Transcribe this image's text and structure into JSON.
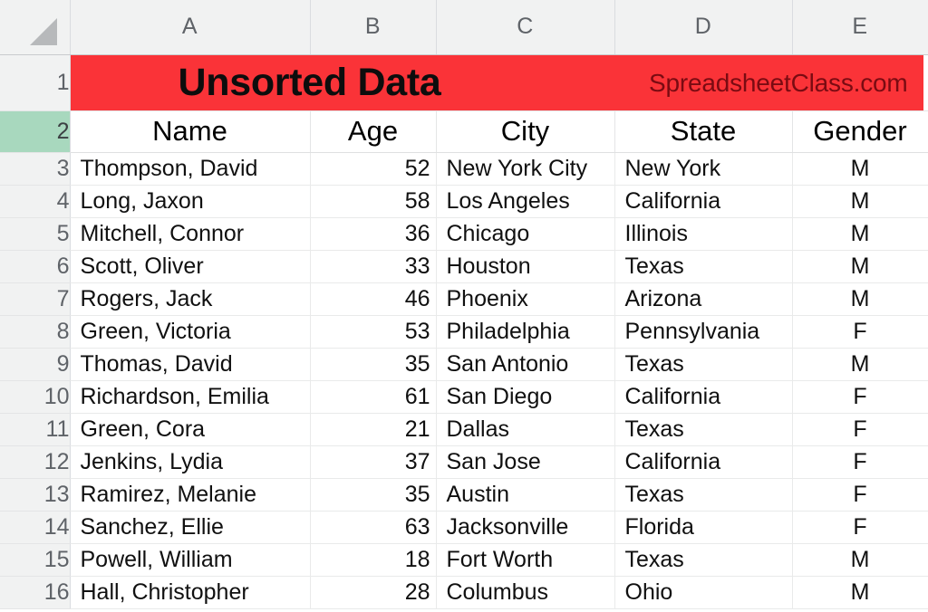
{
  "app": {
    "type": "spreadsheet",
    "select_all_icon": "corner-triangle-icon"
  },
  "colors": {
    "banner_fill": "#FA3338",
    "banner_title_text": "#0D0D0D",
    "banner_brand_text": "#7A0B12",
    "selected_row_header_fill": "#A8D8BE",
    "header_strip_fill": "#F1F2F2",
    "grid_line": "#E9EAEA"
  },
  "column_headers": [
    "A",
    "B",
    "C",
    "D",
    "E"
  ],
  "row_headers": [
    "1",
    "2",
    "3",
    "4",
    "5",
    "6",
    "7",
    "8",
    "9",
    "10",
    "11",
    "12",
    "13",
    "14",
    "15",
    "16"
  ],
  "selected_row_header": "2",
  "banner": {
    "title": "Unsorted Data",
    "brand": "SpreadsheetClass.com"
  },
  "table": {
    "headers": [
      "Name",
      "Age",
      "City",
      "State",
      "Gender"
    ],
    "rows": [
      {
        "name": "Thompson, David",
        "age": "52",
        "city": "New York City",
        "state": "New York",
        "gender": "M"
      },
      {
        "name": "Long, Jaxon",
        "age": "58",
        "city": "Los Angeles",
        "state": "California",
        "gender": "M"
      },
      {
        "name": "Mitchell, Connor",
        "age": "36",
        "city": "Chicago",
        "state": "Illinois",
        "gender": "M"
      },
      {
        "name": "Scott, Oliver",
        "age": "33",
        "city": "Houston",
        "state": "Texas",
        "gender": "M"
      },
      {
        "name": "Rogers, Jack",
        "age": "46",
        "city": "Phoenix",
        "state": "Arizona",
        "gender": "M"
      },
      {
        "name": "Green, Victoria",
        "age": "53",
        "city": "Philadelphia",
        "state": "Pennsylvania",
        "gender": "F"
      },
      {
        "name": "Thomas, David",
        "age": "35",
        "city": "San Antonio",
        "state": "Texas",
        "gender": "M"
      },
      {
        "name": "Richardson, Emilia",
        "age": "61",
        "city": "San Diego",
        "state": "California",
        "gender": "F"
      },
      {
        "name": "Green, Cora",
        "age": "21",
        "city": "Dallas",
        "state": "Texas",
        "gender": "F"
      },
      {
        "name": "Jenkins, Lydia",
        "age": "37",
        "city": "San Jose",
        "state": "California",
        "gender": "F"
      },
      {
        "name": "Ramirez, Melanie",
        "age": "35",
        "city": "Austin",
        "state": "Texas",
        "gender": "F"
      },
      {
        "name": "Sanchez, Ellie",
        "age": "63",
        "city": "Jacksonville",
        "state": "Florida",
        "gender": "F"
      },
      {
        "name": "Powell, William",
        "age": "18",
        "city": "Fort Worth",
        "state": "Texas",
        "gender": "M"
      },
      {
        "name": "Hall, Christopher",
        "age": "28",
        "city": "Columbus",
        "state": "Ohio",
        "gender": "M"
      }
    ]
  }
}
